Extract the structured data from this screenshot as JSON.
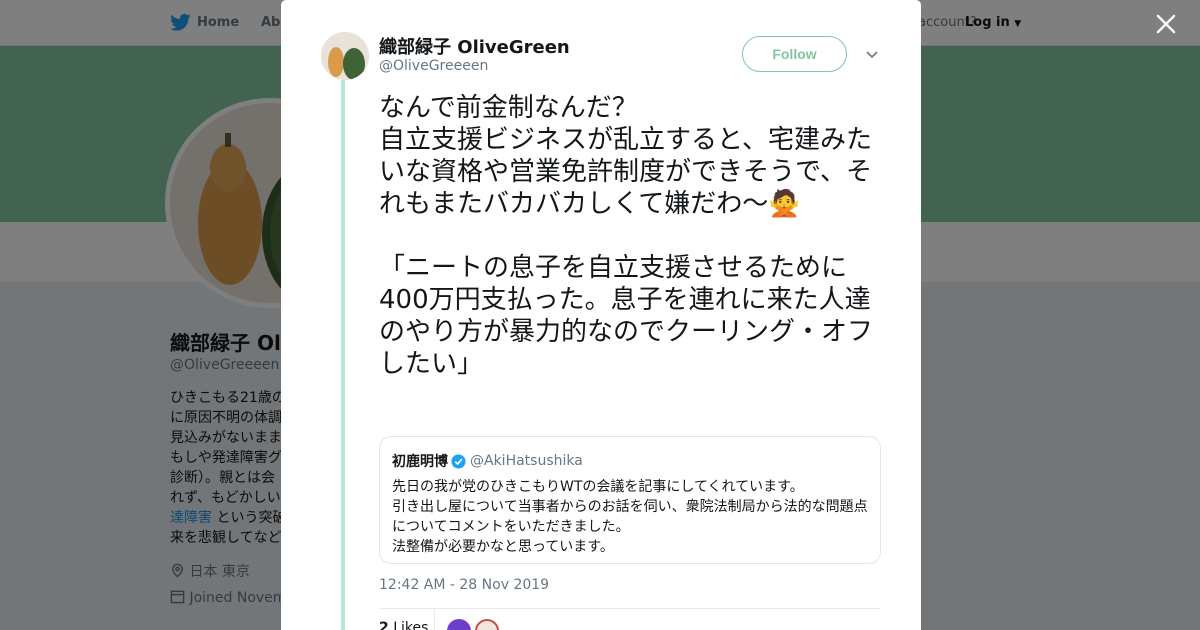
{
  "background": {
    "nav": {
      "home": "Home",
      "about": "Abo",
      "account": "account?",
      "login": "Log in"
    },
    "profile": {
      "name": "織部緑子 Ol",
      "handle": "@OliveGreeeen",
      "bio_lines": [
        "ひきこもる21歳の",
        "に原因不明の体調",
        "見込みがないまま",
        "もしや発達障害グ",
        "診断）。親とは会",
        "れず、もどかしい"
      ],
      "bio_link": "達障害",
      "bio_after_link": " という突破",
      "bio_last": "来を悲観してなど",
      "location": "日本 東京",
      "joined": "Joined Novem"
    }
  },
  "tweet": {
    "author_name": "織部緑子 OliveGreen",
    "author_handle": "@OliveGreeeen",
    "follow_label": "Follow",
    "text": "なんで前金制なんだ？\n自立支援ビジネスが乱立すると、宅建みたいな資格や営業免許制度ができそうで、それもまたバカバカしくて嫌だわ～🙅\n\n「ニートの息子を自立支援させるために400万円支払った。息子を連れに来た人達のやり方が暴力的なのでクーリング・オフしたい」",
    "quote": {
      "name": "初鹿明博",
      "handle": "@AkiHatsushika",
      "text": "先日の我が党のひきこもりWTの会議を記事にしてくれています。\n引き出し屋について当事者からのお話を伺い、衆院法制局から法的な問題点についてコメントをいただきました。\n法整備が必要かなと思っています。"
    },
    "timestamp": "12:42 AM - 28 Nov 2019",
    "likes_count": "2",
    "likes_label": "Likes"
  },
  "icons": {
    "nav_logo": "twitter-bird-icon",
    "close": "close-icon",
    "caret": "chevron-down-icon",
    "verified": "verified-badge-icon",
    "location": "location-pin-icon",
    "calendar": "calendar-icon"
  },
  "colors": {
    "accent": "#82c7a0",
    "link": "#1b95e0",
    "verified": "#1da1f2"
  }
}
